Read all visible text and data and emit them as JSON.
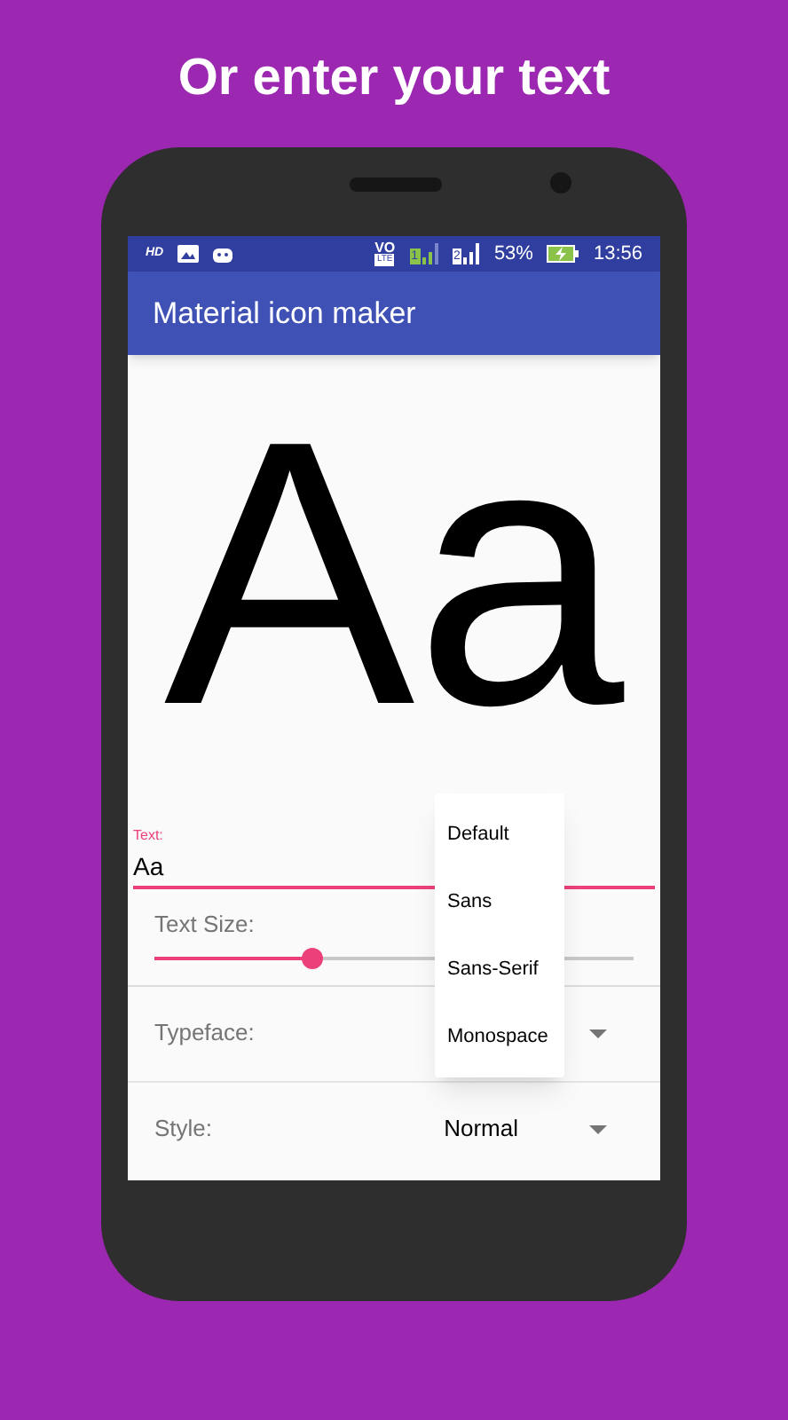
{
  "headline": "Or enter your text",
  "status_bar": {
    "hd": "HD",
    "volte_top": "VO",
    "volte_bottom": "LTE",
    "sim_1": "1",
    "sim_2": "2",
    "battery_percent": "53%",
    "time": "13:56"
  },
  "app_bar": {
    "title": "Material icon maker"
  },
  "preview": {
    "text": "Aa"
  },
  "text_field": {
    "label": "Text:",
    "value": "Aa"
  },
  "text_size": {
    "label": "Text Size:",
    "level": 0.33
  },
  "typeface": {
    "label": "Typeface:"
  },
  "style": {
    "label": "Style:",
    "value": "Normal"
  },
  "menu": {
    "items": [
      "Default",
      "Sans",
      "Sans-Serif",
      "Monospace"
    ]
  }
}
